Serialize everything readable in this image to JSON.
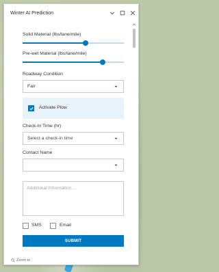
{
  "window": {
    "title": "Winter AI Prediction",
    "controls": {
      "collapse_icon": "chevron-down-icon",
      "maximize_icon": "maximize-icon",
      "close_icon": "close-icon"
    }
  },
  "form": {
    "solid_material": {
      "label": "Solid Material (lbs/lane/mile)",
      "level": 0.62
    },
    "prewet_material": {
      "label": "Pre-wet Material (lbs/lane/mile)",
      "level": 0.79
    },
    "roadway_condition": {
      "label": "Roadway Condition",
      "value": "Fair"
    },
    "activate_plow": {
      "label": "Activate Plow",
      "checked": true
    },
    "checkin_time": {
      "label": "Check-In Time (hr)",
      "placeholder": "Select a check-in time"
    },
    "contact_name": {
      "label": "Contact Name",
      "value": ""
    },
    "additional_info": {
      "placeholder": "Additional information..."
    },
    "sms": {
      "label": "SMS",
      "checked": false
    },
    "email": {
      "label": "Email",
      "checked": false
    },
    "submit_label": "SUBMIT"
  },
  "footer": {
    "zoom_to_label": "Zoom to",
    "zoom_icon": "zoom-to-icon"
  },
  "colors": {
    "accent": "#0079c1",
    "track": "#c6d7ea",
    "plow_bg": "#e8f2fb"
  }
}
